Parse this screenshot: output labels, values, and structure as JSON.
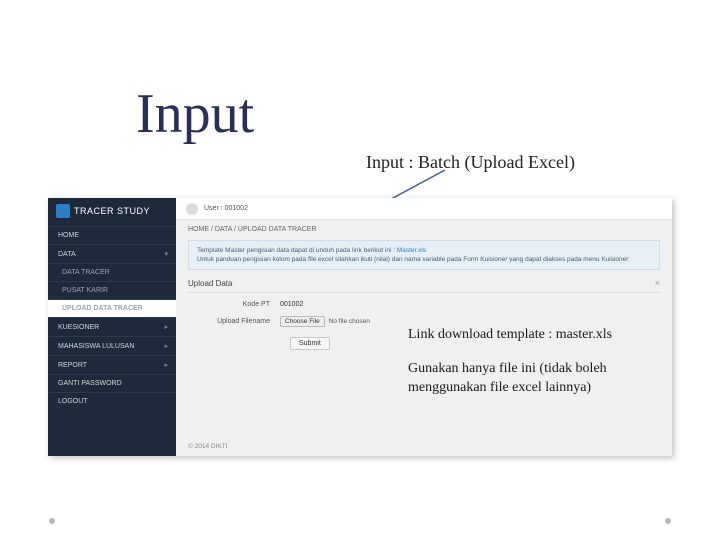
{
  "page_title": "Input",
  "subtitle": "Input : Batch (Upload Excel)",
  "annotations": {
    "link_download": "Link download template : master.xls",
    "gunakan": "Gunakan hanya file ini (tidak boleh menggunakan file excel lainnya)"
  },
  "logo": {
    "text": "TRACER STUDY"
  },
  "user": {
    "label": "User : 001002"
  },
  "breadcrumb": "HOME  /  DATA  /  UPLOAD DATA TRACER",
  "notice": {
    "line1_pre": "Template Master pengisian data dapat di unduh pada link berikut ini : ",
    "line1_link": "Master.xls",
    "line2": "Untuk panduan pengisian kolom pada file excel silahkan ikuti (nilai) dan nama variable pada Form Kuisioner yang dapat diakses pada menu Kuisioner"
  },
  "panel": {
    "title": "Upload Data",
    "close": "×"
  },
  "form": {
    "kode_pt_label": "Kode PT",
    "kode_pt_value": "001002",
    "upload_label": "Upload Filename",
    "file_button": "Choose File",
    "file_status": "No file chosen",
    "submit": "Submit"
  },
  "footer": "© 2014 DIKTI",
  "nav": {
    "home": "HOME",
    "data": "DATA",
    "data_tracer": "DATA TRACER",
    "pusat_karir": "PUSAT KARIR",
    "upload_data_tracer": "UPLOAD DATA TRACER",
    "kuesioner": "KUESIONER",
    "mahasiswa": "MAHASISWA LULUSAN",
    "report": "REPORT",
    "ganti_password": "GANTI PASSWORD",
    "logout": "LOGOUT"
  }
}
